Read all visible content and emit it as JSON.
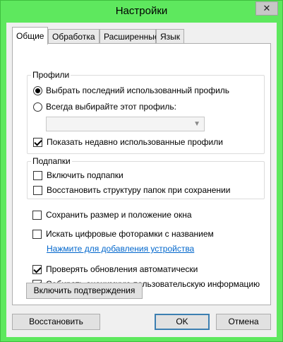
{
  "window": {
    "title": "Настройки",
    "close_glyph": "✕"
  },
  "tabs": [
    {
      "label": "Общие",
      "active": true
    },
    {
      "label": "Обработка"
    },
    {
      "label": "Расширенные"
    },
    {
      "label": "Язык"
    }
  ],
  "profiles": {
    "label": "Профили",
    "radio_last": "Выбрать последний использованный профиль",
    "radio_always": "Всегда выбирайте этот профиль:",
    "profile_select_value": "",
    "show_recent": "Показать недавно использованные профили"
  },
  "subfolders": {
    "label": "Подпапки",
    "include": "Включить подпапки",
    "restore_structure": "Восстановить структуру папок при сохранении"
  },
  "options": {
    "save_window": "Сохранить размер и положение окна",
    "search_frames": "Искать цифровые фоторамки с названием",
    "add_device_link": "Нажмите для добавления устройства",
    "check_updates": "Проверять обновления автоматически",
    "collect_info": "Собирать анонимную пользовательскую информацию",
    "confirmations_button": "Включить подтверждения"
  },
  "footer": {
    "restore_button": "Восстановить",
    "ok_button": "OK",
    "cancel_button": "Отмена"
  },
  "icons": {
    "dropdown": "chevron-down-icon",
    "close": "close-icon"
  }
}
